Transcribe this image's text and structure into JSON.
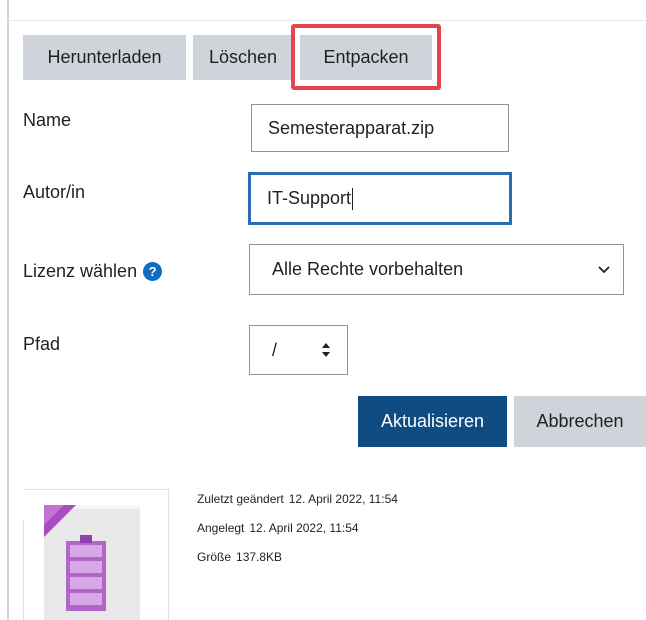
{
  "toolbar": {
    "download_label": "Herunterladen",
    "delete_label": "Löschen",
    "unzip_label": "Entpacken"
  },
  "form": {
    "name_label": "Name",
    "name_value": "Semesterapparat.zip",
    "author_label": "Autor/in",
    "author_value": "IT-Support",
    "license_label": "Lizenz wählen",
    "help_glyph": "?",
    "license_value": "Alle Rechte vorbehalten",
    "path_label": "Pfad",
    "path_value": "/"
  },
  "actions": {
    "update_label": "Aktualisieren",
    "cancel_label": "Abbrechen"
  },
  "file_info": {
    "modified_label": "Zuletzt geändert",
    "modified_value": "12. April 2022, 11:54",
    "created_label": "Angelegt",
    "created_value": "12. April 2022, 11:54",
    "size_label": "Größe",
    "size_value": "137.8KB"
  },
  "colors": {
    "primary": "#0f4c81",
    "secondary": "#ced4da",
    "highlight": "#e5434f",
    "focus": "#2a6fb3",
    "zip_icon": "#a94cc4"
  },
  "icons": {
    "help": "help-icon",
    "select_chevron": "chevron-down-icon",
    "path_spinner": "sort-icon",
    "file": "zip-file-icon"
  }
}
